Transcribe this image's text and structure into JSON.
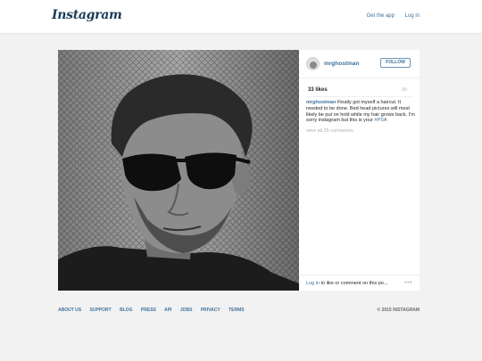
{
  "top": {
    "logo": "Instagram",
    "get_app": "Get the app",
    "login": "Log in"
  },
  "post": {
    "username": "mrghostman",
    "follow_label": "FOLLOW",
    "likes": "33 likes",
    "age": "1h",
    "caption_user": "mrghostman",
    "caption_text": " Finally got myself a haircut. It needed to be done. Bed head pictures will most likely be put on hold while my hair grows back. I'm sorry instagram but this is your ",
    "caption_tag": "#PSA",
    "view_all": "view all 25 comments",
    "login_link": "Log in",
    "login_rest": " to like or comment on this po...",
    "more": "•••"
  },
  "footer": {
    "links": [
      "ABOUT US",
      "SUPPORT",
      "BLOG",
      "PRESS",
      "API",
      "JOBS",
      "PRIVACY",
      "TERMS"
    ],
    "copyright": "© 2015 INSTAGRAM"
  },
  "colors": {
    "link": "#3f729b",
    "background": "#f2f2f2"
  }
}
